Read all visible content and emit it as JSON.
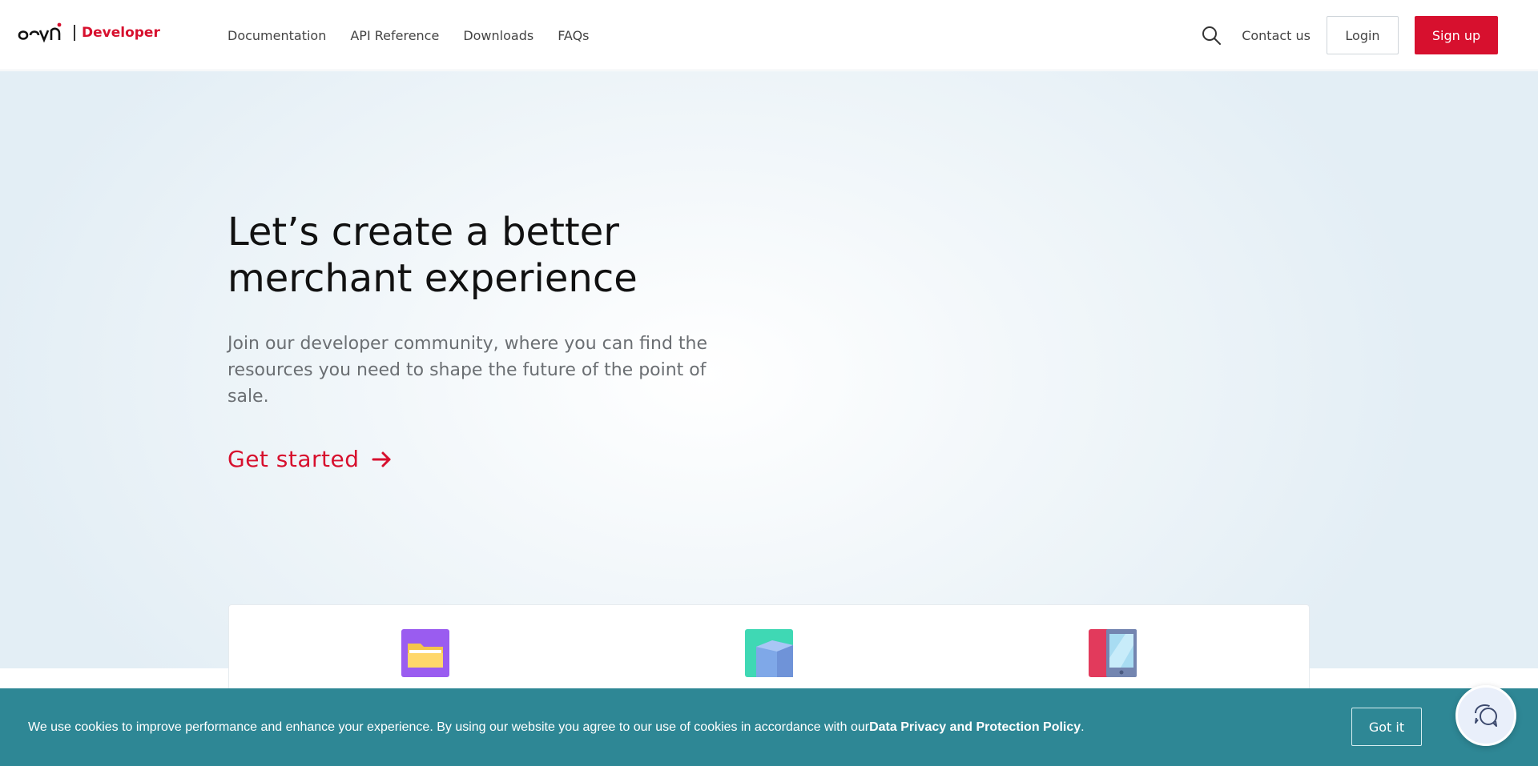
{
  "header": {
    "logo_text": "Developer",
    "nav": [
      {
        "label": "Documentation"
      },
      {
        "label": "API Reference"
      },
      {
        "label": "Downloads"
      },
      {
        "label": "FAQs"
      }
    ],
    "contact_label": "Contact us",
    "login_label": "Login",
    "signup_label": "Sign up"
  },
  "hero": {
    "title_line1": "Let’s create a better",
    "title_line2": "merchant experience",
    "subtitle": "Join our developer community, where you can find the resources you need to shape the future of the point of sale.",
    "cta_label": "Get started"
  },
  "cards": {
    "icons": [
      "folder-icon",
      "box-icon",
      "tablet-icon"
    ]
  },
  "cookie": {
    "text_before": "We use cookies to improve performance and enhance your experience. By using our website you agree to our use of cookies in accordance with our ",
    "policy_link": "Data Privacy and Protection Policy",
    "text_after": ".",
    "button_label": "Got it"
  },
  "colors": {
    "brand_red": "#d7102e",
    "cookie_teal": "#2e8795"
  }
}
